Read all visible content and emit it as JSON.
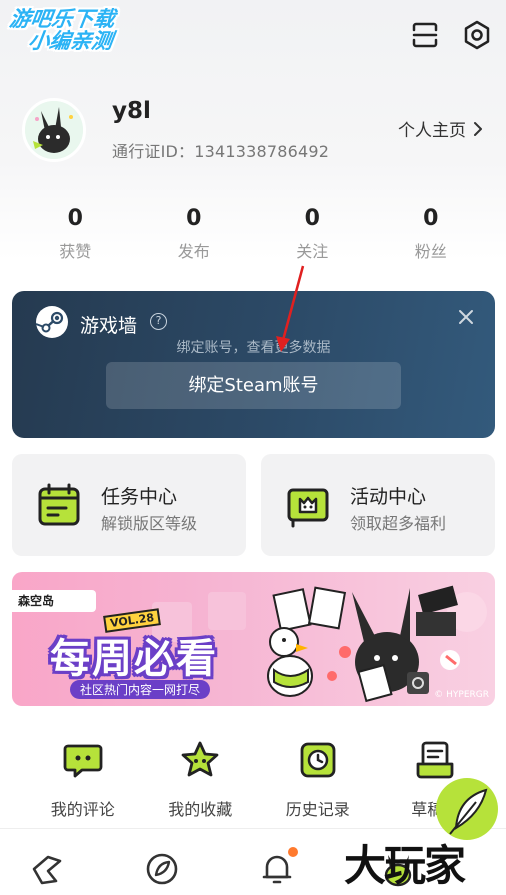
{
  "watermark": {
    "line1": "游吧乐下载",
    "line2": "小编亲测",
    "bottom": "大玩家"
  },
  "profile": {
    "username": "y8l",
    "pass_id": "通行证ID：1341338786492",
    "homepage_label": "个人主页",
    "homepage_icon": "chevron-right-icon"
  },
  "stats": [
    {
      "num": "0",
      "label": "获赞"
    },
    {
      "num": "0",
      "label": "发布"
    },
    {
      "num": "0",
      "label": "关注"
    },
    {
      "num": "0",
      "label": "粉丝"
    }
  ],
  "game_wall": {
    "title": "游戏墙",
    "subtitle": "绑定账号，查看更多数据",
    "button": "绑定Steam账号",
    "bg_color": "#2c4a67"
  },
  "tiles": [
    {
      "title": "任务中心",
      "subtitle": "解锁版区等级",
      "icon": "task-calendar-icon"
    },
    {
      "title": "活动中心",
      "subtitle": "领取超多福利",
      "icon": "activity-flag-icon"
    }
  ],
  "banner": {
    "tag": "森空岛",
    "vol": "VOL.28",
    "title": "每周必看",
    "subtitle": "社区热门内容一网打尽",
    "copyright": "© HYPERGR"
  },
  "shortcuts": [
    {
      "label": "我的评论",
      "icon": "comment-icon"
    },
    {
      "label": "我的收藏",
      "icon": "star-icon"
    },
    {
      "label": "历史记录",
      "icon": "history-clock-icon"
    },
    {
      "label": "草稿箱",
      "icon": "draft-box-icon"
    }
  ],
  "nav": [
    "home-icon",
    "discover-icon",
    "bell-icon",
    "profile-icon"
  ],
  "colors": {
    "accent": "#b6e23a",
    "dark": "#222222",
    "badge": "#ff7a2e"
  }
}
